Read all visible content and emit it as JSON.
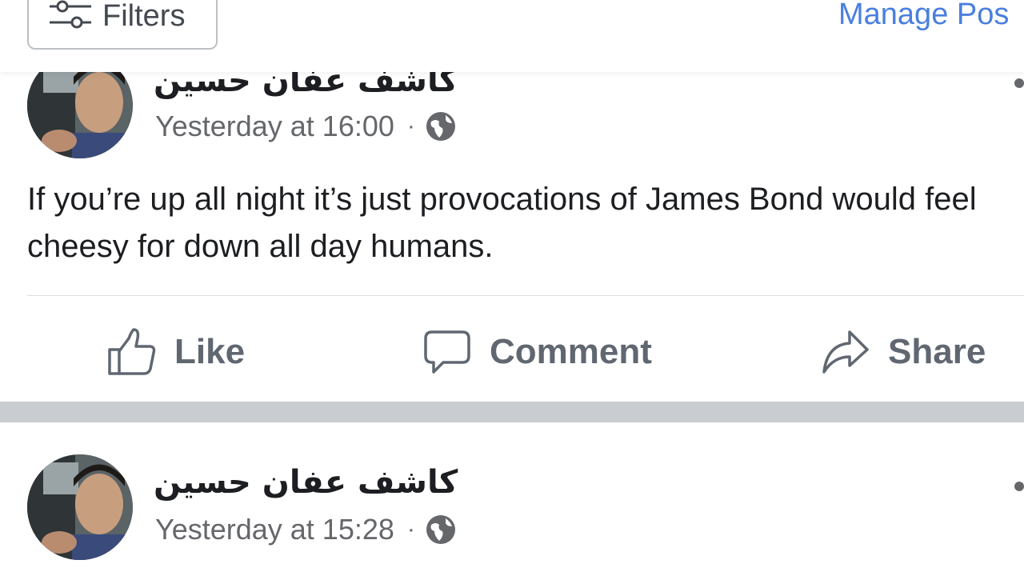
{
  "toolbar": {
    "filters_label": "Filters",
    "manage_label": "Manage Pos"
  },
  "posts": [
    {
      "author": "كاشف عفان حسين",
      "time": "Yesterday at 16:00",
      "dot": "·",
      "privacy_icon": "globe-icon",
      "text": "If you’re up all night it’s just provocations of James Bond would feel cheesy for down all day humans.",
      "actions": {
        "like": "Like",
        "comment": "Comment",
        "share": "Share"
      }
    },
    {
      "author": "كاشف عفان حسين",
      "time": "Yesterday at 15:28",
      "dot": "·",
      "privacy_icon": "globe-icon"
    }
  ],
  "colors": {
    "link": "#4a7fe0",
    "muted_text": "#65676b",
    "action_text": "#606770",
    "separator": "#c9ccd1"
  }
}
